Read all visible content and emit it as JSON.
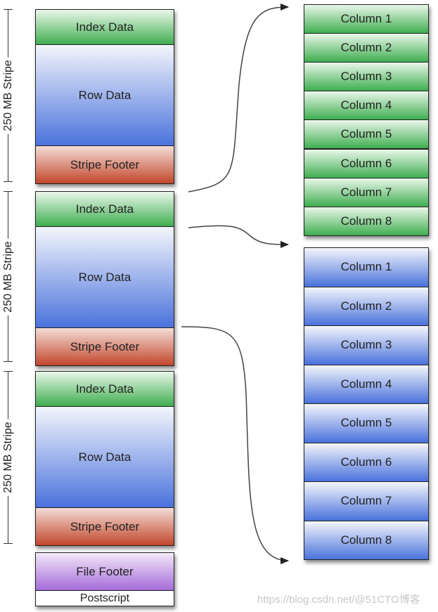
{
  "stripes": [
    {
      "size_label": "250 MB Stripe",
      "index": "Index Data",
      "row": "Row Data",
      "footer": "Stripe Footer"
    },
    {
      "size_label": "250 MB Stripe",
      "index": "Index Data",
      "row": "Row Data",
      "footer": "Stripe Footer"
    },
    {
      "size_label": "250 MB Stripe",
      "index": "Index Data",
      "row": "Row Data",
      "footer": "Stripe Footer"
    }
  ],
  "file_footer": "File Footer",
  "postscript": "Postscript",
  "index_columns": [
    "Column 1",
    "Column 2",
    "Column 3",
    "Column 4",
    "Column 5",
    "Column 6",
    "Column 7",
    "Column 8"
  ],
  "row_columns": [
    "Column 1",
    "Column 2",
    "Column 3",
    "Column 4",
    "Column 5",
    "Column 6",
    "Column 7",
    "Column 8"
  ],
  "watermark": "https://blog.csdn.net/@51CTO博客",
  "colors": {
    "index": "#3fae50",
    "row": "#4a72dc",
    "footer": "#c2472c",
    "file_footer": "#a56bd9"
  }
}
